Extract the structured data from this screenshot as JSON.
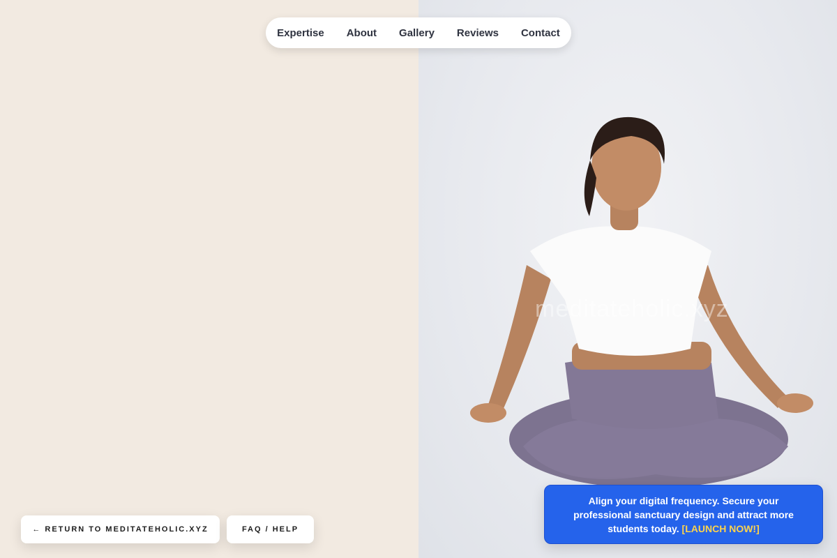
{
  "nav": {
    "items": [
      {
        "label": "Expertise"
      },
      {
        "label": "About"
      },
      {
        "label": "Gallery"
      },
      {
        "label": "Reviews"
      },
      {
        "label": "Contact"
      }
    ]
  },
  "hero": {
    "watermark": "meditateholic.xyz"
  },
  "buttons": {
    "return_label": "← RETURN TO MEDITATEHOLIC.XYZ",
    "faq_label": "FAQ / HELP"
  },
  "cta": {
    "text": "Align your digital frequency. Secure your professional sanctuary design and attract more students today.",
    "link": "[LAUNCH NOW!]"
  },
  "colors": {
    "left_bg": "#f2eae1",
    "cta_bg": "#2563eb",
    "cta_link": "#fcd34d"
  }
}
